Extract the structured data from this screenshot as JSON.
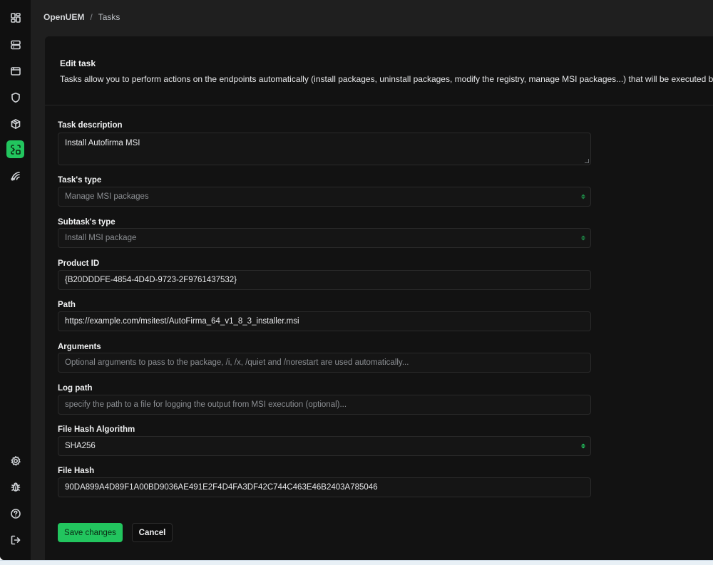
{
  "breadcrumb": {
    "root": "OpenUEM",
    "separator": "/",
    "current": "Tasks"
  },
  "sidebar": {
    "items": [
      {
        "icon": "dashboard-icon"
      },
      {
        "icon": "server-icon"
      },
      {
        "icon": "window-icon"
      },
      {
        "icon": "shield-icon"
      },
      {
        "icon": "package-icon"
      },
      {
        "icon": "tasks-icon",
        "active": true
      },
      {
        "icon": "remote-assist-icon"
      }
    ],
    "bottom_items": [
      {
        "icon": "gear-icon"
      },
      {
        "icon": "bug-icon"
      },
      {
        "icon": "help-icon"
      },
      {
        "icon": "logout-icon"
      }
    ]
  },
  "card": {
    "title": "Edit task",
    "description": "Tasks allow you to perform actions on the endpoints automatically (install packages, uninstall packages, modify the registry, manage MSI packages...) that will be executed by OpenUEM agents"
  },
  "form": {
    "task_description": {
      "label": "Task description",
      "value": "Install Autofirma MSI"
    },
    "task_type": {
      "label": "Task's type",
      "value": "Manage MSI packages"
    },
    "subtask_type": {
      "label": "Subtask's type",
      "value": "Install MSI package"
    },
    "product_id": {
      "label": "Product ID",
      "value": "{B20DDDFE-4854-4D4D-9723-2F9761437532}"
    },
    "path": {
      "label": "Path",
      "value": "https://example.com/msitest/AutoFirma_64_v1_8_3_installer.msi"
    },
    "arguments": {
      "label": "Arguments",
      "placeholder": "Optional arguments to pass to the package, /i, /x, /quiet and /norestart are used automatically..."
    },
    "log_path": {
      "label": "Log path",
      "placeholder": "specify the path to a file for logging the output from MSI execution (optional)..."
    },
    "hash_algorithm": {
      "label": "File Hash Algorithm",
      "value": "SHA256"
    },
    "file_hash": {
      "label": "File Hash",
      "value": "90DA899A4D89F1A00BD9036AE491E2F4D4FA3DF42C744C463E46B2403A785046"
    }
  },
  "actions": {
    "save_label": "Save changes",
    "cancel_label": "Cancel"
  },
  "colors": {
    "accent": "#22c55e",
    "background": "#1f1f1f",
    "card": "#121212",
    "sidebar": "#101010"
  }
}
